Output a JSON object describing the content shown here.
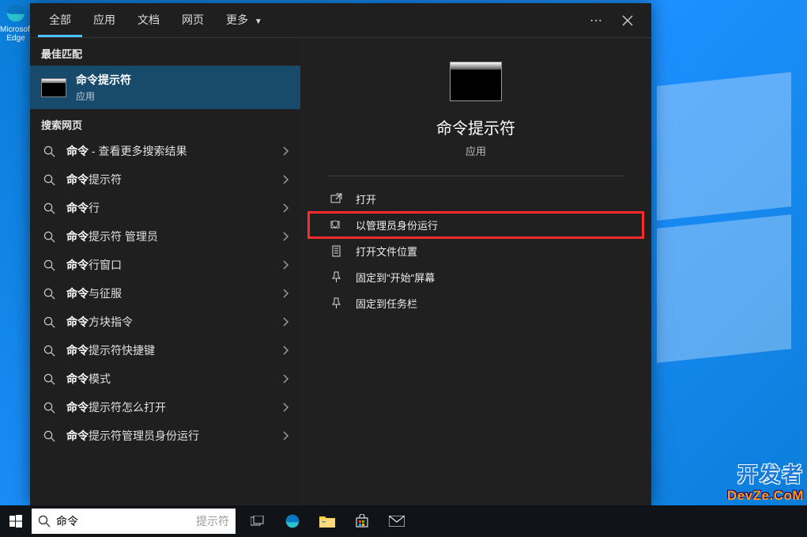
{
  "desktop": {
    "edge_label": "Microsoft Edge"
  },
  "tabs": {
    "all": "全部",
    "apps": "应用",
    "docs": "文档",
    "web": "网页",
    "more": "更多"
  },
  "left": {
    "best_match_header": "最佳匹配",
    "best_match_title": "命令提示符",
    "best_match_sub": "应用",
    "web_header": "搜索网页",
    "results": [
      "命令 - 查看更多搜索结果",
      "命令提示符",
      "命令行",
      "命令提示符 管理员",
      "命令行窗口",
      "命令与征服",
      "命令方块指令",
      "命令提示符快捷键",
      "命令模式",
      "命令提示符怎么打开",
      "命令提示符管理员身份运行"
    ]
  },
  "right": {
    "title": "命令提示符",
    "sub": "应用",
    "actions": {
      "open": "打开",
      "run_admin": "以管理员身份运行",
      "open_location": "打开文件位置",
      "pin_start": "固定到\"开始\"屏幕",
      "pin_taskbar": "固定到任务栏"
    }
  },
  "taskbar": {
    "search_value": "命令",
    "search_placeholder": "提示符"
  },
  "watermark": {
    "l1": "开发者",
    "l2": "DevZe.CoM"
  }
}
